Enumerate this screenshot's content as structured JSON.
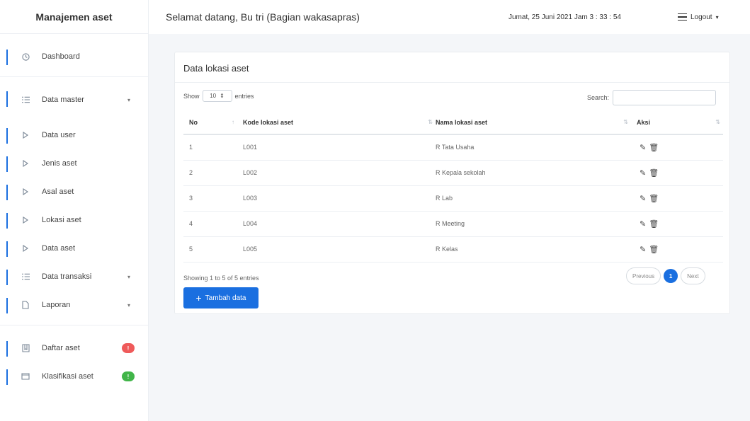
{
  "sidebar": {
    "brand": "Manajemen aset",
    "items": [
      {
        "label": "Dashboard",
        "icon": "clock-icon"
      },
      {
        "label": "Data master",
        "icon": "list-icon"
      },
      {
        "label": "Data user",
        "icon": "play-icon"
      },
      {
        "label": "Jenis aset",
        "icon": "play-icon"
      },
      {
        "label": "Asal aset",
        "icon": "play-icon"
      },
      {
        "label": "Lokasi aset",
        "icon": "play-icon"
      },
      {
        "label": "Data aset",
        "icon": "play-icon"
      },
      {
        "label": "Data transaksi",
        "icon": "list-icon"
      },
      {
        "label": "Laporan",
        "icon": "file-icon"
      },
      {
        "label": "Daftar aset",
        "icon": "book-icon"
      },
      {
        "label": "Klasifikasi aset",
        "icon": "folder-icon"
      }
    ],
    "badges": {
      "daftar_aset_color": "#ef5a5a",
      "klasifikasi_aset_color": "#41b549"
    }
  },
  "header": {
    "welcome": "Selamat datang, Bu tri (Bagian wakasapras)",
    "datetime": "Jumat, 25 Juni 2021  Jam 3 : 33 : 54",
    "logout": "Logout"
  },
  "card": {
    "title": "Data lokasi aset",
    "show_label": "Show",
    "show_value": "10",
    "entries_label": "entries",
    "search_label": "Search:",
    "columns": [
      "No",
      "Kode lokasi aset",
      "Nama lokasi aset",
      "Aksi"
    ],
    "rows": [
      {
        "no": "1",
        "kode": "L001",
        "nama": "R Tata Usaha"
      },
      {
        "no": "2",
        "kode": "L002",
        "nama": "R Kepala sekolah"
      },
      {
        "no": "3",
        "kode": "L003",
        "nama": "R Lab"
      },
      {
        "no": "4",
        "kode": "L004",
        "nama": "R Meeting"
      },
      {
        "no": "5",
        "kode": "L005",
        "nama": "R Kelas"
      }
    ],
    "info": "Showing 1 to 5 of 5 entries",
    "add_button": "Tambah data",
    "pagination": {
      "previous": "Previous",
      "current": "1",
      "next": "Next"
    }
  },
  "colors": {
    "accent": "#1a6fe0"
  }
}
